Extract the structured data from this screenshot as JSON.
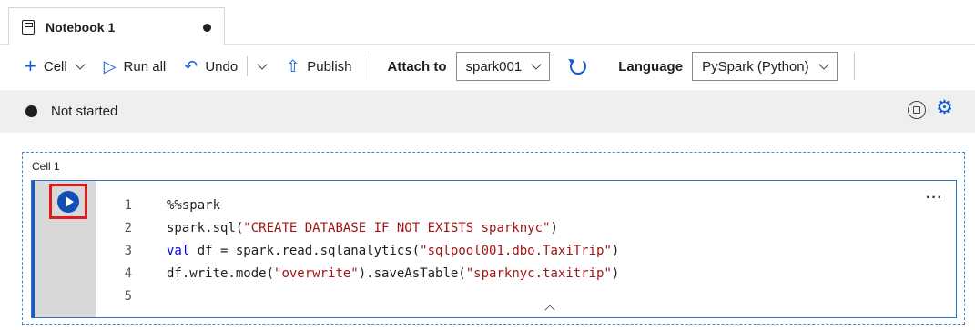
{
  "tab": {
    "title": "Notebook 1",
    "unsaved_indicator": "●"
  },
  "toolbar": {
    "cell_label": "Cell",
    "run_all_label": "Run all",
    "undo_label": "Undo",
    "publish_label": "Publish",
    "attach_to_label": "Attach to",
    "attach_to_value": "spark001",
    "language_label": "Language",
    "language_value": "PySpark (Python)"
  },
  "status": {
    "text": "Not started"
  },
  "cell": {
    "label": "Cell 1",
    "more_label": "···",
    "lines": [
      {
        "num": "1",
        "segments": [
          {
            "t": "%%spark",
            "c": "plain"
          }
        ]
      },
      {
        "num": "2",
        "segments": [
          {
            "t": "spark.sql(",
            "c": "plain"
          },
          {
            "t": "\"CREATE DATABASE IF NOT EXISTS sparknyc\"",
            "c": "str"
          },
          {
            "t": ")",
            "c": "plain"
          }
        ]
      },
      {
        "num": "3",
        "segments": [
          {
            "t": "val",
            "c": "kw"
          },
          {
            "t": " df = spark.read.sqlanalytics(",
            "c": "plain"
          },
          {
            "t": "\"sqlpool001.dbo.TaxiTrip\"",
            "c": "str"
          },
          {
            "t": ")",
            "c": "plain"
          }
        ]
      },
      {
        "num": "4",
        "segments": [
          {
            "t": "df.write.mode(",
            "c": "plain"
          },
          {
            "t": "\"overwrite\"",
            "c": "str"
          },
          {
            "t": ").saveAsTable(",
            "c": "plain"
          },
          {
            "t": "\"sparknyc.taxitrip\"",
            "c": "str"
          },
          {
            "t": ")",
            "c": "plain"
          }
        ]
      },
      {
        "num": "5",
        "segments": []
      }
    ]
  },
  "colors": {
    "accent": "#0f5bd6",
    "highlight": "#e01a1a",
    "string": "#a31515",
    "keyword": "#0000ff"
  },
  "icons": [
    "notebook-icon",
    "plus-icon",
    "play-icon",
    "undo-icon",
    "publish-icon",
    "refresh-icon",
    "stop-session-icon",
    "gear-icon",
    "run-cell-icon",
    "more-icon",
    "chevron-up-icon"
  ]
}
